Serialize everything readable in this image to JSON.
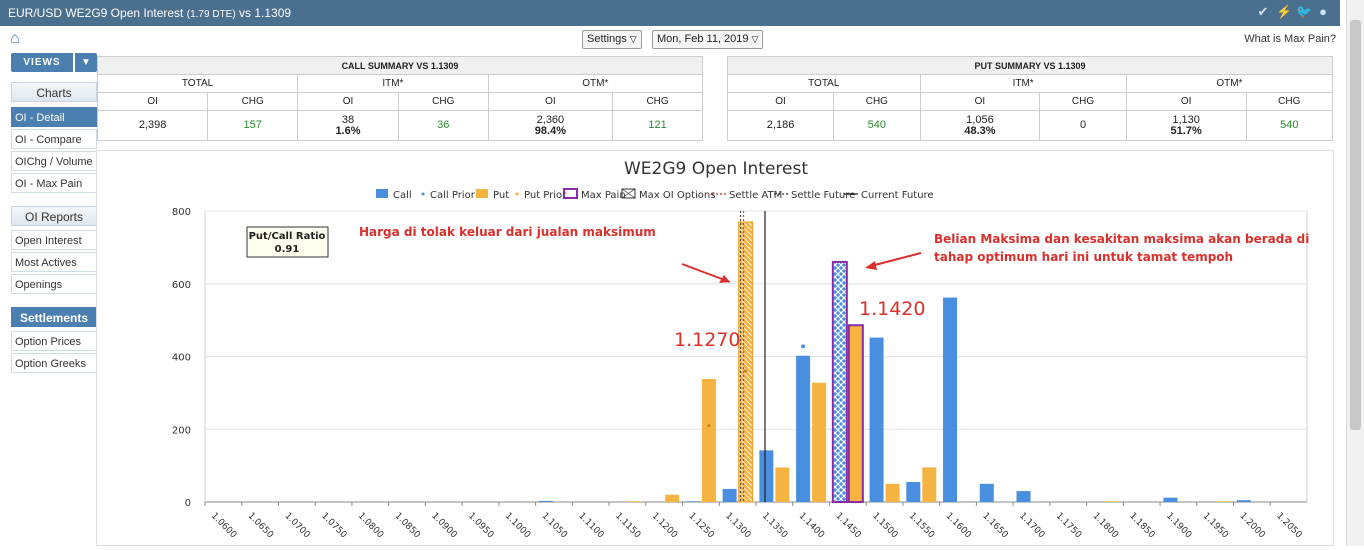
{
  "window": {
    "title_main": "EUR/USD WE2G9 Open Interest",
    "title_dte": "(1.79 DTE)",
    "title_vs": "vs  1.1309"
  },
  "toolbar": {
    "settings_label": "Settings",
    "date_label": "Mon, Feb 11, 2019",
    "maxpain_link": "What is Max Pain?"
  },
  "sidebar": {
    "views_label": "VIEWS",
    "charts_header": "Charts",
    "charts_items": [
      "OI - Detail",
      "OI - Compare",
      "OIChg / Volume",
      "OI - Max Pain"
    ],
    "oi_reports_header": "OI Reports",
    "oi_reports_items": [
      "Open Interest",
      "Most Actives",
      "Openings"
    ],
    "settlements_header": "Settlements",
    "settlements_items": [
      "Option Prices",
      "Option Greeks"
    ]
  },
  "call_summary": {
    "title": "CALL SUMMARY VS 1.1309",
    "groups": [
      "TOTAL",
      "ITM*",
      "OTM*"
    ],
    "cols": [
      "OI",
      "CHG",
      "OI",
      "CHG",
      "OI",
      "CHG"
    ],
    "total_oi": "2,398",
    "total_chg": "157",
    "itm_oi": "38",
    "itm_pct": "1.6%",
    "itm_chg": "36",
    "otm_oi": "2,360",
    "otm_pct": "98.4%",
    "otm_chg": "121"
  },
  "put_summary": {
    "title": "PUT SUMMARY VS 1.1309",
    "groups": [
      "TOTAL",
      "ITM*",
      "OTM*"
    ],
    "cols": [
      "OI",
      "CHG",
      "OI",
      "CHG",
      "OI",
      "CHG"
    ],
    "total_oi": "2,186",
    "total_chg": "540",
    "itm_oi": "1,056",
    "itm_pct": "48.3%",
    "itm_chg": "0",
    "otm_oi": "1,130",
    "otm_pct": "51.7%",
    "otm_chg": "540"
  },
  "colors": {
    "call": "#4a8ee0",
    "put": "#f5b342",
    "maxpain": "#8a2ca8",
    "annotation": "#d9302c",
    "accent": "#4a7fb0"
  },
  "annotations": {
    "left_text": "Harga di tolak keluar dari jualan maksimum",
    "right_text_1": "Belian Maksima dan kesakitan maksima akan berada di",
    "right_text_2": "tahap optimum hari ini untuk tamat tempoh",
    "price_left": "1.1270",
    "price_right": "1.1420"
  },
  "chart_data": {
    "type": "bar",
    "title": "WE2G9 Open Interest",
    "legend": [
      "Call",
      "Call Prior",
      "Put",
      "Put Prior",
      "Max Pain",
      "Max OI Options",
      "Settle ATM",
      "Settle Future",
      "Current Future"
    ],
    "legend_placement": "top-center",
    "ratio_label": "Put/Call Ratio",
    "ratio_value": "0.91",
    "categories": [
      "1.0600",
      "1.0650",
      "1.0700",
      "1.0750",
      "1.0800",
      "1.0850",
      "1.0900",
      "1.0950",
      "1.1000",
      "1.1050",
      "1.1100",
      "1.1150",
      "1.1200",
      "1.1250",
      "1.1300",
      "1.1350",
      "1.1400",
      "1.1450",
      "1.1500",
      "1.1550",
      "1.1600",
      "1.1650",
      "1.1700",
      "1.1750",
      "1.1800",
      "1.1850",
      "1.1900",
      "1.1950",
      "1.2000",
      "1.2050"
    ],
    "series": [
      {
        "name": "Call",
        "values": [
          0,
          0,
          0,
          0,
          0,
          0,
          0,
          0,
          0,
          3,
          0,
          0,
          0,
          2,
          36,
          142,
          402,
          660,
          452,
          55,
          562,
          50,
          30,
          0,
          0,
          0,
          12,
          0,
          5,
          0
        ]
      },
      {
        "name": "Put",
        "values": [
          0,
          0,
          0,
          0,
          0,
          0,
          0,
          0,
          0,
          0,
          0,
          2,
          20,
          338,
          770,
          95,
          328,
          486,
          50,
          95,
          0,
          0,
          0,
          0,
          2,
          0,
          0,
          2,
          0,
          0
        ]
      }
    ],
    "call_prior": [
      {
        "x": "1.1400",
        "y": 428
      }
    ],
    "put_prior": [
      {
        "x": "1.1250",
        "y": 210
      },
      {
        "x": "1.1300",
        "y": 360
      }
    ],
    "ylim": [
      0,
      800
    ],
    "yticks": [
      0,
      200,
      400,
      600,
      800
    ],
    "grid": true
  }
}
